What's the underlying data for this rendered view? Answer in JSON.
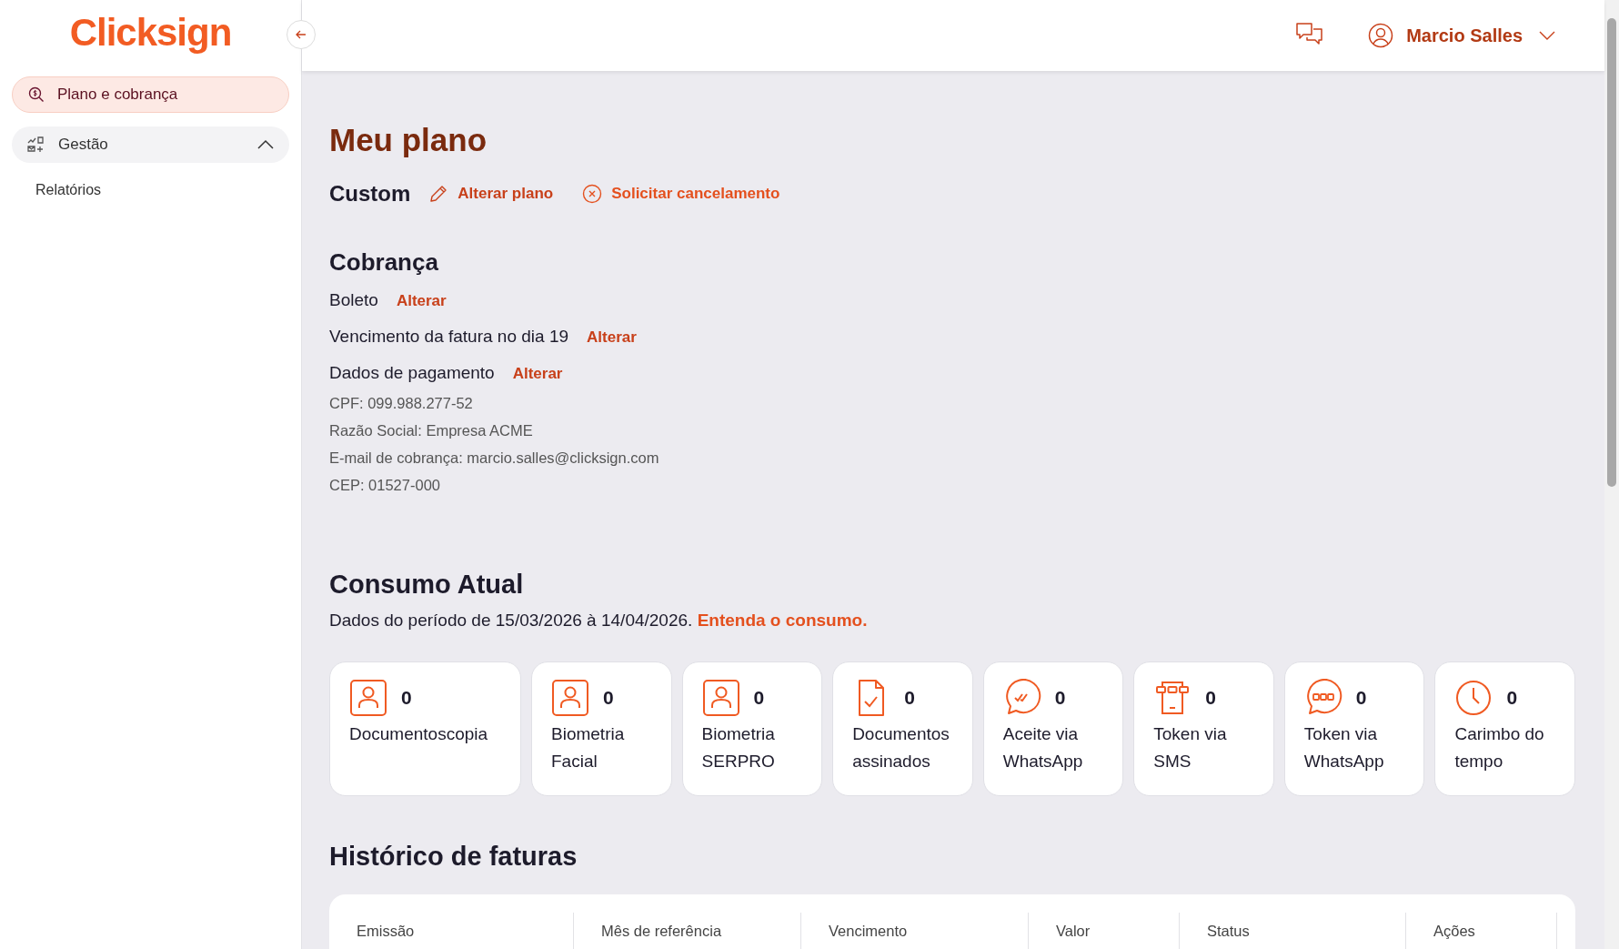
{
  "sidebar": {
    "logo": "Clicksign",
    "items": [
      {
        "label": "Plano e cobrança",
        "kind": "billing",
        "selected": true
      },
      {
        "label": "Gestão",
        "kind": "management",
        "selected": false,
        "expanded": true,
        "children": [
          {
            "label": "Relatórios",
            "selected": false
          }
        ]
      }
    ]
  },
  "header": {
    "user": "Marcio Salles"
  },
  "plan": {
    "title": "Meu plano",
    "name": "Custom",
    "actions": [
      {
        "label": "Alterar plano",
        "kind": "edit"
      },
      {
        "label": "Solicitar cancelamento",
        "kind": "cancel"
      }
    ]
  },
  "billing": {
    "title": "Cobrança",
    "rows": [
      {
        "label": "Boleto",
        "action": "Alterar"
      },
      {
        "label": "Vencimento da fatura no dia 19",
        "action": "Alterar"
      },
      {
        "label": "Dados de pagamento",
        "action": "Alterar"
      }
    ],
    "details": [
      "CPF: 099.988.277-52",
      "Razão Social: Empresa ACME",
      "E-mail de cobrança: marcio.salles@clicksign.com",
      "CEP: 01527-000"
    ]
  },
  "consumption": {
    "title": "Consumo Atual",
    "period": "Dados do período de 15/03/2026 à 14/04/2026.",
    "link": "Entenda o consumo.",
    "cards": [
      {
        "kind": "person",
        "value": "0",
        "label": "Documentoscopia"
      },
      {
        "kind": "person",
        "value": "0",
        "label": "Biometria Facial"
      },
      {
        "kind": "person",
        "value": "0",
        "label": "Biometria SERPRO"
      },
      {
        "kind": "document",
        "value": "0",
        "label": "Documentos assinados"
      },
      {
        "kind": "chat-check",
        "value": "0",
        "label": "Aceite via WhatsApp"
      },
      {
        "kind": "phone-code",
        "value": "0",
        "label": "Token via SMS"
      },
      {
        "kind": "chat-code",
        "value": "0",
        "label": "Token via WhatsApp"
      },
      {
        "kind": "clock",
        "value": "0",
        "label": "Carimbo do tempo"
      }
    ]
  },
  "invoices": {
    "title": "Histórico de faturas",
    "columns": [
      "Emissão",
      "Mês de referência",
      "Vencimento",
      "Valor",
      "Status",
      "Ações"
    ]
  }
}
